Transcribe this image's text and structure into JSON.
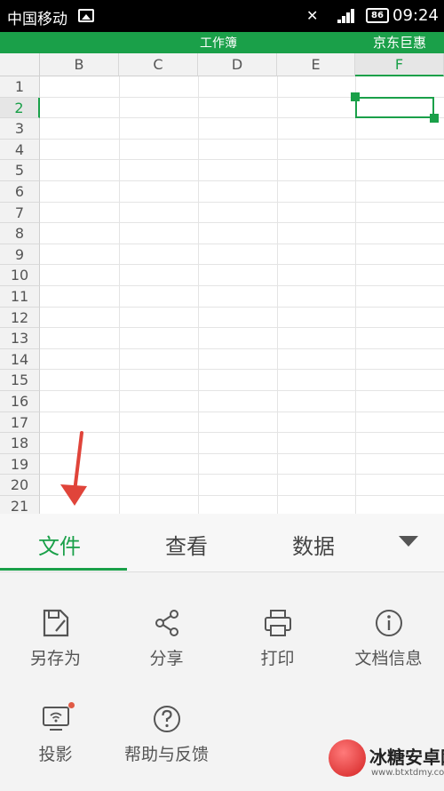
{
  "status_bar": {
    "carrier": "中国移动",
    "battery": "86",
    "time": "09:24"
  },
  "title_bar": {
    "title": "工作簿",
    "right_label": "京东巨惠"
  },
  "sheet": {
    "columns": [
      "B",
      "C",
      "D",
      "E",
      "F"
    ],
    "selected_column": "F",
    "rows": [
      "1",
      "2",
      "3",
      "4",
      "5",
      "6",
      "7",
      "8",
      "9",
      "10",
      "11",
      "12",
      "13",
      "14",
      "15",
      "16",
      "17",
      "18",
      "19",
      "20",
      "21"
    ],
    "selected_row": "2"
  },
  "tabs": [
    {
      "label": "文件",
      "active": true
    },
    {
      "label": "查看",
      "active": false
    },
    {
      "label": "数据",
      "active": false
    }
  ],
  "actions": [
    {
      "label": "另存为",
      "icon": "save-as-icon"
    },
    {
      "label": "分享",
      "icon": "share-icon"
    },
    {
      "label": "打印",
      "icon": "print-icon"
    },
    {
      "label": "文档信息",
      "icon": "info-icon"
    },
    {
      "label": "投影",
      "icon": "projection-icon"
    },
    {
      "label": "帮助与反馈",
      "icon": "help-icon"
    }
  ],
  "watermark": {
    "name": "冰糖安卓网",
    "url": "www.btxtdmy.com"
  },
  "colors": {
    "accent": "#1aa049",
    "annotation_arrow": "#e0443a",
    "notification_dot": "#e05a45"
  }
}
